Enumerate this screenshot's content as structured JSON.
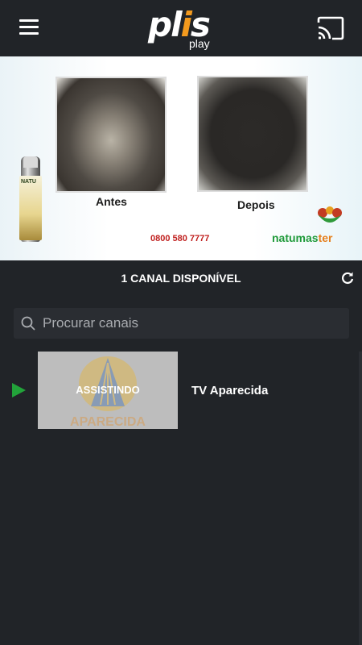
{
  "app": {
    "logo_main_a": "pl",
    "logo_main_b": "i",
    "logo_main_c": "s",
    "logo_sub": "play",
    "accent_color": "#f39a1e",
    "background_color": "#212428"
  },
  "toolbar": {
    "menu_icon": "hamburger-menu-icon",
    "cast_icon": "cast-icon"
  },
  "player": {
    "caption_before": "Antes",
    "caption_after": "Depois",
    "phone": "0800 580 7777",
    "product_label": "NATU",
    "brand_a": "natumas",
    "brand_b": "ter"
  },
  "channels_header": {
    "count_label": "1 CANAL DISPONÍVEL",
    "refresh_icon": "refresh-icon"
  },
  "search": {
    "placeholder": "Procurar canais",
    "value": "",
    "icon": "search-icon"
  },
  "channels": [
    {
      "name": "TV Aparecida",
      "status": "ASSISTINDO",
      "logo_text": "APARECIDA",
      "playing": true,
      "play_color": "#22a33a"
    }
  ]
}
